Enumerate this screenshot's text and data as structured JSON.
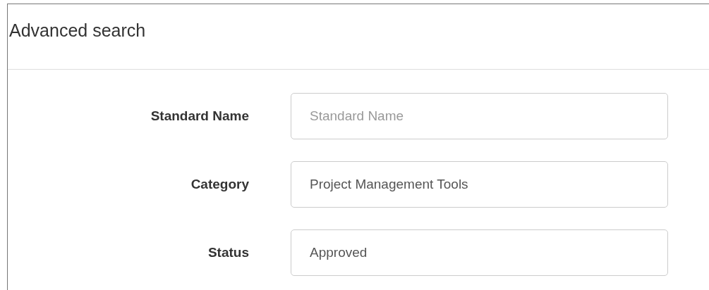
{
  "panel": {
    "title": "Advanced search"
  },
  "fields": [
    {
      "label": "Standard Name",
      "placeholder": "Standard Name"
    },
    {
      "label": "Category",
      "value": "Project Management Tools"
    },
    {
      "label": "Status",
      "value": "Approved"
    }
  ]
}
